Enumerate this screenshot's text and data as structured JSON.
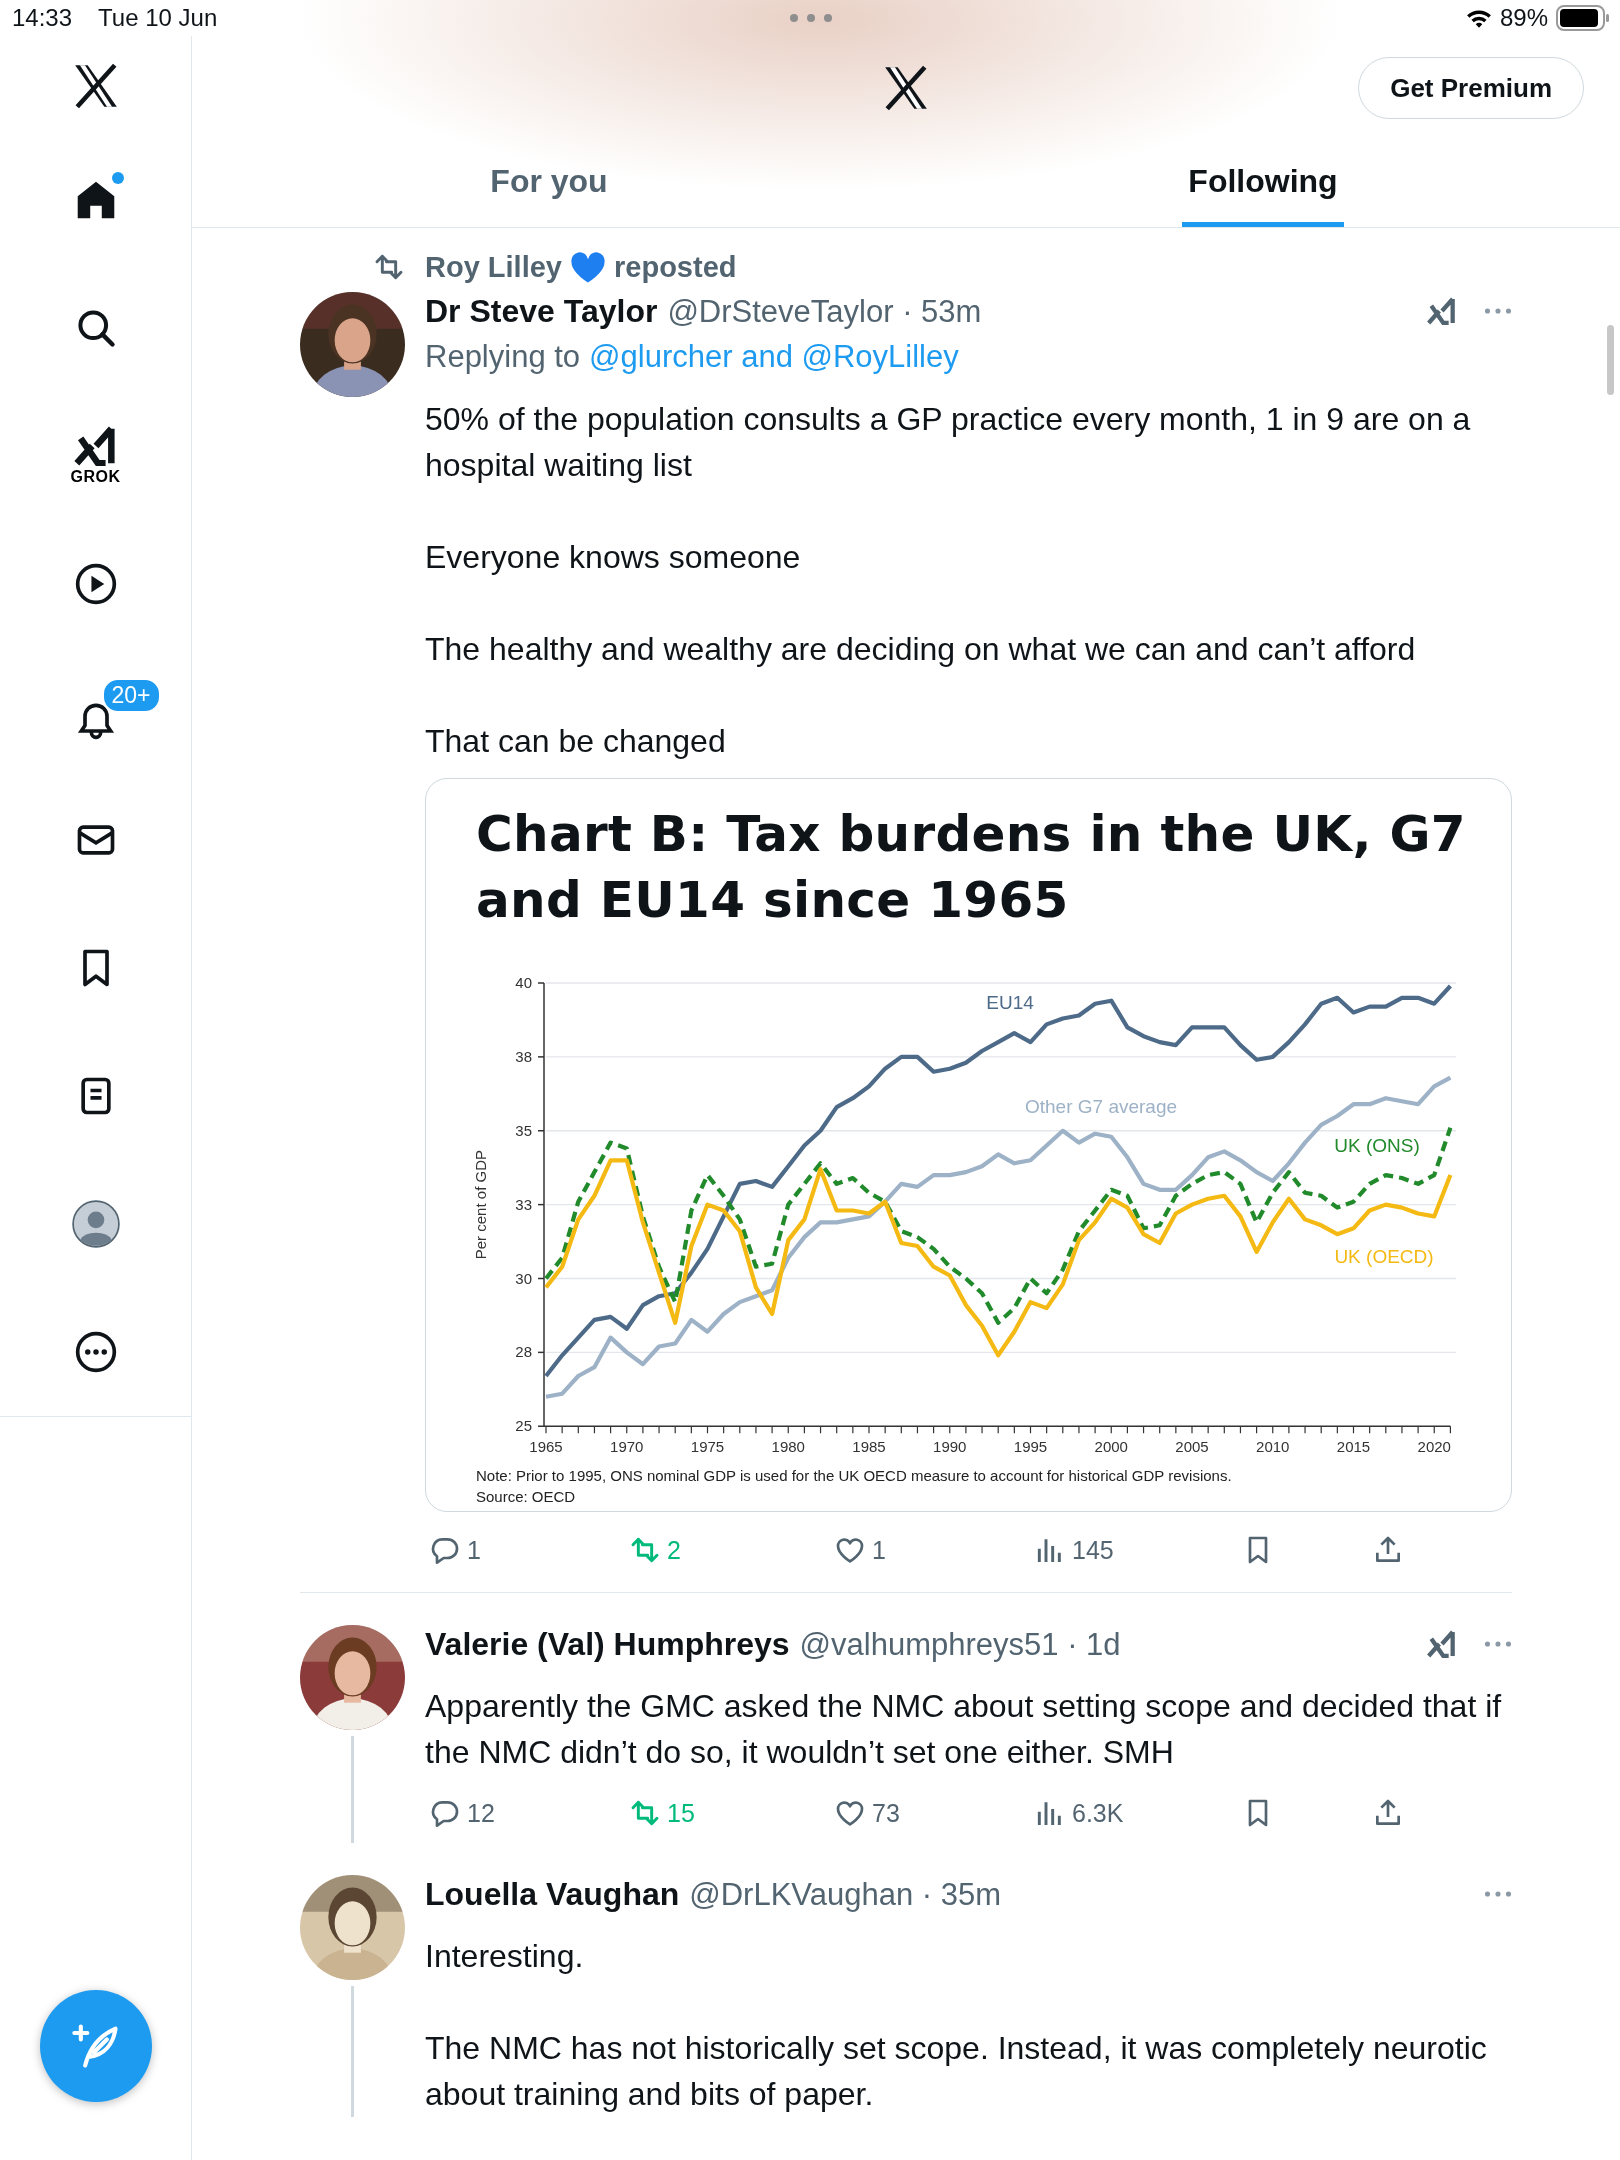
{
  "status_bar": {
    "time": "14:33",
    "date": "Tue 10 Jun",
    "battery": "89%"
  },
  "sidebar": {
    "items": [
      {
        "kind": "home",
        "selected": true,
        "dot": true
      },
      {
        "kind": "search",
        "selected": false
      },
      {
        "kind": "grok",
        "selected": false,
        "label": "GROK"
      },
      {
        "kind": "video",
        "selected": false
      },
      {
        "kind": "notifications",
        "selected": false,
        "badge": "20+"
      },
      {
        "kind": "messages",
        "selected": false
      },
      {
        "kind": "bookmarks",
        "selected": false
      },
      {
        "kind": "lists",
        "selected": false
      },
      {
        "kind": "profile",
        "selected": false
      },
      {
        "kind": "more",
        "selected": false
      }
    ]
  },
  "header": {
    "premium_button": "Get Premium",
    "tabs": [
      {
        "label": "For you",
        "selected": false
      },
      {
        "label": "Following",
        "selected": true
      }
    ]
  },
  "tweets": [
    {
      "repost_by": "Roy Lilley",
      "repost_label": "reposted",
      "name": "Dr Steve Taylor",
      "meta": "@DrSteveTaylor · 53m",
      "reply_prefix": "Replying to",
      "reply_to": "@glurcher and @RoyLilley",
      "grok": true,
      "thread_line": false,
      "body": [
        "50% of the population consults a GP practice every month, 1 in 9 are on a hospital waiting list",
        "Everyone knows someone",
        "The healthy and wealthy are deciding on what we can and can’t afford",
        "That can be changed"
      ],
      "media": {
        "note": "Note: Prior to 1995, ONS nominal GDP is used for the UK OECD measure to account for historical GDP revisions.",
        "source": "Source: OECD",
        "chart_data": {
          "type": "line",
          "title": "Chart B: Tax burdens in the UK, G7 and EU14 since 1965",
          "ylabel": "Per cent of GDP",
          "x": [
            1965,
            1966,
            1967,
            1968,
            1969,
            1970,
            1971,
            1972,
            1973,
            1974,
            1975,
            1976,
            1977,
            1978,
            1979,
            1980,
            1981,
            1982,
            1983,
            1984,
            1985,
            1986,
            1987,
            1988,
            1989,
            1990,
            1991,
            1992,
            1993,
            1994,
            1995,
            1996,
            1997,
            1998,
            1999,
            2000,
            2001,
            2002,
            2003,
            2004,
            2005,
            2006,
            2007,
            2008,
            2009,
            2010,
            2011,
            2012,
            2013,
            2014,
            2015,
            2016,
            2017,
            2018,
            2019,
            2020,
            2021
          ],
          "xlim": [
            1965,
            2021
          ],
          "ylim": [
            25,
            40
          ],
          "grid": true,
          "xticks": [
            1965,
            1970,
            1975,
            1980,
            1985,
            1990,
            1995,
            2000,
            2005,
            2010,
            2015,
            2020
          ],
          "yticks": [
            {
              "value": 25,
              "label": "25"
            },
            {
              "value": 27.5,
              "label": "28"
            },
            {
              "value": 30,
              "label": "30"
            },
            {
              "value": 32.5,
              "label": "33"
            },
            {
              "value": 35,
              "label": "35"
            },
            {
              "value": 37.5,
              "label": "38"
            },
            {
              "value": 40,
              "label": "40"
            }
          ],
          "series": [
            {
              "name": "EU14",
              "color": "#4d6b89",
              "line_style": "solid",
              "values": [
                26.7,
                27.4,
                28.0,
                28.6,
                28.7,
                28.3,
                29.1,
                29.4,
                29.5,
                30.2,
                31.0,
                32.1,
                33.2,
                33.3,
                33.1,
                33.8,
                34.5,
                35.0,
                35.8,
                36.1,
                36.5,
                37.1,
                37.5,
                37.5,
                37.0,
                37.1,
                37.3,
                37.7,
                38.0,
                38.3,
                38.0,
                38.6,
                38.8,
                38.9,
                39.3,
                39.4,
                38.5,
                38.2,
                38.0,
                37.9,
                38.5,
                38.5,
                38.5,
                37.9,
                37.4,
                37.5,
                38.0,
                38.6,
                39.3,
                39.5,
                39.0,
                39.2,
                39.2,
                39.5,
                39.5,
                39.3,
                39.9
              ]
            },
            {
              "name": "Other G7 average",
              "color": "#9db2c6",
              "line_style": "solid",
              "values": [
                26.0,
                26.1,
                26.7,
                27.0,
                28.0,
                27.5,
                27.1,
                27.7,
                27.8,
                28.6,
                28.2,
                28.8,
                29.2,
                29.4,
                29.6,
                30.7,
                31.4,
                31.9,
                31.9,
                32.0,
                32.1,
                32.6,
                33.2,
                33.1,
                33.5,
                33.5,
                33.6,
                33.8,
                34.2,
                33.9,
                34.0,
                34.5,
                35.0,
                34.6,
                34.9,
                34.8,
                34.1,
                33.2,
                33.0,
                33.0,
                33.5,
                34.1,
                34.3,
                34.0,
                33.6,
                33.3,
                33.9,
                34.6,
                35.2,
                35.5,
                35.9,
                35.9,
                36.1,
                36.0,
                35.9,
                36.5,
                36.8
              ]
            },
            {
              "name": "UK (ONS)",
              "color": "#218a2b",
              "line_style": "dashed",
              "values": [
                30.0,
                30.7,
                32.6,
                33.6,
                34.6,
                34.4,
                32.1,
                30.4,
                29.2,
                32.3,
                33.5,
                32.8,
                32.0,
                30.4,
                30.5,
                32.5,
                33.2,
                33.9,
                33.2,
                33.4,
                32.9,
                32.6,
                31.6,
                31.4,
                31.0,
                30.4,
                30.0,
                29.5,
                28.5,
                29.0,
                30.0,
                29.5,
                30.3,
                31.6,
                32.3,
                33.0,
                32.8,
                31.7,
                31.8,
                32.8,
                33.2,
                33.5,
                33.6,
                33.2,
                31.9,
                32.9,
                33.6,
                32.9,
                32.8,
                32.4,
                32.6,
                33.2,
                33.5,
                33.4,
                33.2,
                33.5,
                35.1
              ]
            },
            {
              "name": "UK (OECD)",
              "color": "#f4b912",
              "line_style": "solid",
              "values": [
                29.7,
                30.4,
                32.0,
                32.8,
                34.0,
                34.0,
                31.9,
                30.2,
                28.5,
                31.1,
                32.5,
                32.3,
                31.6,
                29.7,
                28.8,
                31.3,
                32.0,
                33.7,
                32.3,
                32.3,
                32.2,
                32.6,
                31.2,
                31.1,
                30.4,
                30.1,
                29.1,
                28.4,
                27.4,
                28.2,
                29.2,
                29.0,
                29.8,
                31.3,
                31.9,
                32.7,
                32.4,
                31.5,
                31.2,
                32.2,
                32.5,
                32.7,
                32.8,
                32.1,
                30.9,
                31.9,
                32.7,
                32.0,
                31.8,
                31.5,
                31.7,
                32.3,
                32.5,
                32.4,
                32.2,
                32.1,
                33.5
              ]
            }
          ]
        }
      },
      "actions": [
        {
          "kind": "reply",
          "count": "1",
          "active": false
        },
        {
          "kind": "repost",
          "count": "2",
          "active": true
        },
        {
          "kind": "like",
          "count": "1",
          "active": false
        },
        {
          "kind": "views",
          "count": "145"
        },
        {
          "kind": "bookmark",
          "active": false
        },
        {
          "kind": "share"
        }
      ]
    },
    {
      "name": "Valerie (Val) Humphreys",
      "meta": "@valhumphreys51 · 1d",
      "grok": true,
      "thread_line": true,
      "body": [
        "Apparently the GMC asked the NMC about setting scope and decided that if the NMC didn’t do so, it wouldn’t set one either. SMH"
      ],
      "actions": [
        {
          "kind": "reply",
          "count": "12",
          "active": false
        },
        {
          "kind": "repost",
          "count": "15",
          "active": true
        },
        {
          "kind": "like",
          "count": "73",
          "active": false
        },
        {
          "kind": "views",
          "count": "6.3K"
        },
        {
          "kind": "bookmark",
          "active": false
        },
        {
          "kind": "share"
        }
      ]
    },
    {
      "name": "Louella Vaughan",
      "meta": "@DrLKVaughan · 35m",
      "grok": false,
      "thread_line": true,
      "body": [
        "Interesting.",
        "The NMC has not historically set scope. Instead, it was completely neurotic about training and bits of paper."
      ]
    }
  ]
}
